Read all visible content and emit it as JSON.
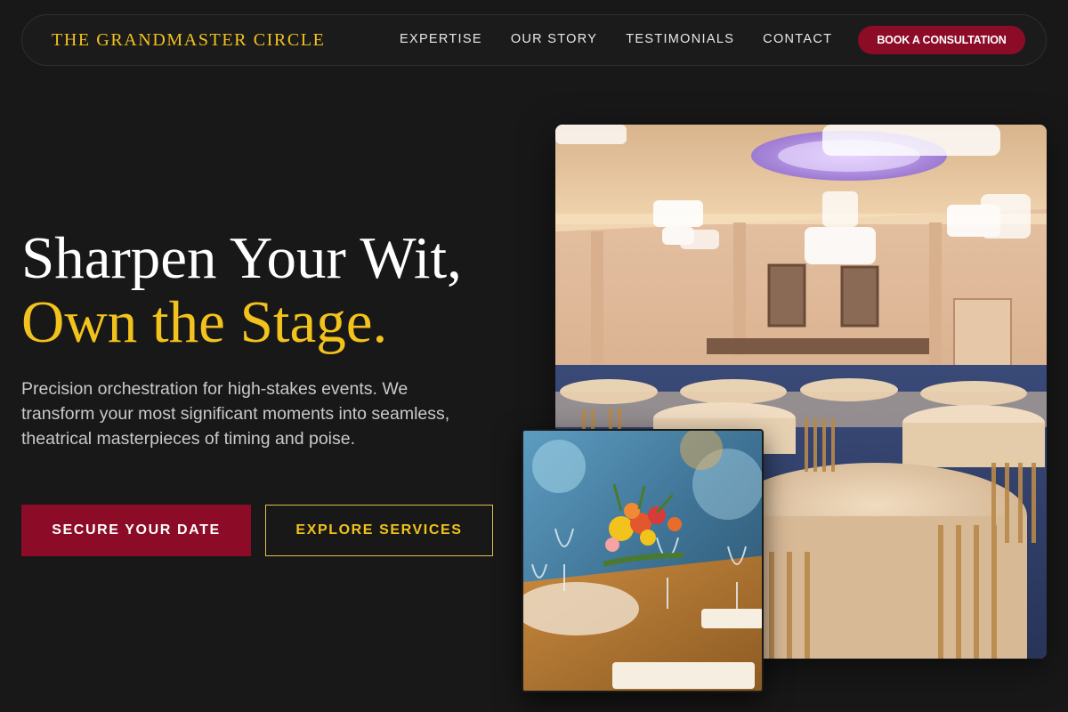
{
  "nav": {
    "brand": "THE GRANDMASTER CIRCLE",
    "links": [
      "EXPERTISE",
      "OUR STORY",
      "TESTIMONIALS",
      "CONTACT"
    ],
    "cta": "BOOK A CONSULTATION"
  },
  "hero": {
    "headline_line1": "Sharpen Your Wit,",
    "headline_line2": "Own the Stage.",
    "subcopy": "Precision orchestration for high-stakes events. We transform your most significant moments into seamless, theatrical masterpieces of timing and poise.",
    "primary_cta": "SECURE YOUR DATE",
    "secondary_cta": "EXPLORE SERVICES"
  },
  "images": {
    "main": "ballroom-photo",
    "inset": "table-centerpiece-photo"
  },
  "colors": {
    "background": "#181818",
    "gold": "#f2c21d",
    "burgundy": "#8c0b27"
  }
}
